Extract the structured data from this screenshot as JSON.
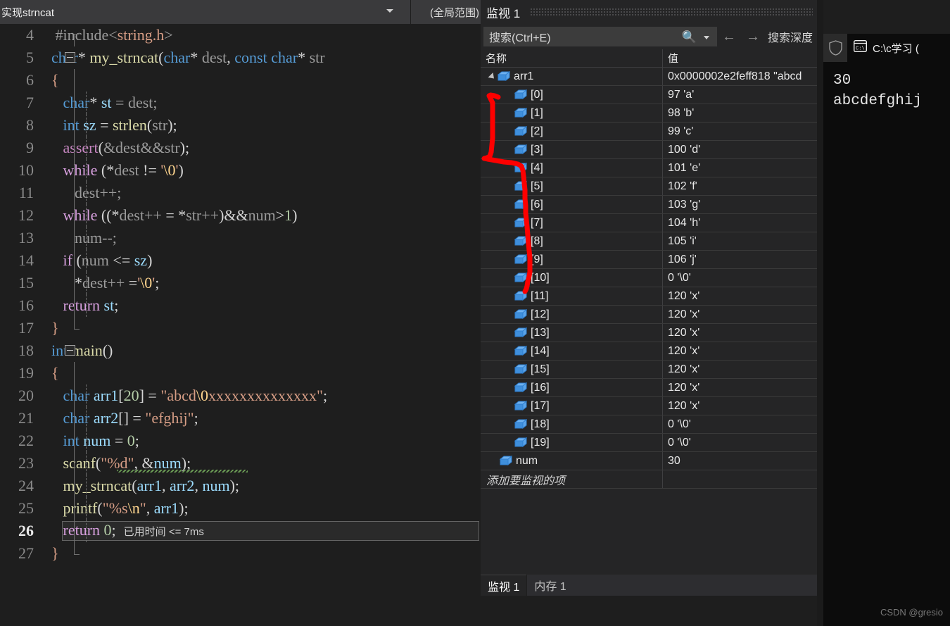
{
  "navbar": {
    "member_dropdown": "实现strncat",
    "scope_dropdown": "(全局范围)",
    "caret_icon": "chevron-down-icon"
  },
  "editor": {
    "current_line": 26,
    "inline_hint": "已用时间 <= 7ms",
    "lines": [
      {
        "n": 4,
        "text": "#include<string.h>"
      },
      {
        "n": 5,
        "text": "char* my_strncat(char* dest, const char* str"
      },
      {
        "n": 6,
        "text": "{"
      },
      {
        "n": 7,
        "text": "char* st = dest;"
      },
      {
        "n": 8,
        "text": "int sz = strlen(str);"
      },
      {
        "n": 9,
        "text": "assert(&dest&&str);"
      },
      {
        "n": 10,
        "text": "while (*dest != '\\0')"
      },
      {
        "n": 11,
        "text": "dest++;"
      },
      {
        "n": 12,
        "text": "while ((*dest++ = *str++)&&num>1)"
      },
      {
        "n": 13,
        "text": "num--;"
      },
      {
        "n": 14,
        "text": "if (num <= sz)"
      },
      {
        "n": 15,
        "text": "*dest++ ='\\0';"
      },
      {
        "n": 16,
        "text": "return st;"
      },
      {
        "n": 17,
        "text": "}"
      },
      {
        "n": 18,
        "text": "int main()"
      },
      {
        "n": 19,
        "text": "{"
      },
      {
        "n": 20,
        "text": "char arr1[20] = \"abcd\\0xxxxxxxxxxxxxx\";"
      },
      {
        "n": 21,
        "text": "char arr2[] = \"efghij\";"
      },
      {
        "n": 22,
        "text": "int num = 0;"
      },
      {
        "n": 23,
        "text": "scanf(\"%d\", &num);"
      },
      {
        "n": 24,
        "text": "my_strncat(arr1, arr2, num);"
      },
      {
        "n": 25,
        "text": "printf(\"%s\\n\", arr1);"
      },
      {
        "n": 26,
        "text": "return 0;"
      },
      {
        "n": 27,
        "text": "}"
      }
    ]
  },
  "watch": {
    "title": "监视 1",
    "search_placeholder": "搜索(Ctrl+E)",
    "search_icon": "search-icon",
    "search_caret_icon": "chevron-down-icon",
    "back_icon": "arrow-left-icon",
    "forward_icon": "arrow-right-icon",
    "depth_label": "搜索深度",
    "columns": {
      "name": "名称",
      "value": "值"
    },
    "add_item_placeholder": "添加要监视的项",
    "rows": [
      {
        "name": "arr1",
        "value": "0x0000002e2feff818 \"abcd",
        "level": 0,
        "expanded": true
      },
      {
        "name": "[0]",
        "value": "97 'a'",
        "level": 1
      },
      {
        "name": "[1]",
        "value": "98 'b'",
        "level": 1
      },
      {
        "name": "[2]",
        "value": "99 'c'",
        "level": 1
      },
      {
        "name": "[3]",
        "value": "100 'd'",
        "level": 1
      },
      {
        "name": "[4]",
        "value": "101 'e'",
        "level": 1
      },
      {
        "name": "[5]",
        "value": "102 'f'",
        "level": 1
      },
      {
        "name": "[6]",
        "value": "103 'g'",
        "level": 1
      },
      {
        "name": "[7]",
        "value": "104 'h'",
        "level": 1
      },
      {
        "name": "[8]",
        "value": "105 'i'",
        "level": 1
      },
      {
        "name": "[9]",
        "value": "106 'j'",
        "level": 1
      },
      {
        "name": "[10]",
        "value": "0 '\\0'",
        "level": 1
      },
      {
        "name": "[11]",
        "value": "120 'x'",
        "level": 1
      },
      {
        "name": "[12]",
        "value": "120 'x'",
        "level": 1
      },
      {
        "name": "[13]",
        "value": "120 'x'",
        "level": 1
      },
      {
        "name": "[14]",
        "value": "120 'x'",
        "level": 1
      },
      {
        "name": "[15]",
        "value": "120 'x'",
        "level": 1
      },
      {
        "name": "[16]",
        "value": "120 'x'",
        "level": 1
      },
      {
        "name": "[17]",
        "value": "120 'x'",
        "level": 1
      },
      {
        "name": "[18]",
        "value": "0 '\\0'",
        "level": 1
      },
      {
        "name": "[19]",
        "value": "0 '\\0'",
        "level": 1
      },
      {
        "name": "num",
        "value": "30",
        "level": 0
      }
    ],
    "tabs": [
      {
        "label": "监视 1",
        "active": true
      },
      {
        "label": "内存 1",
        "active": false
      }
    ]
  },
  "console": {
    "shield_icon": "shield-icon",
    "tab_icon": "command-prompt-icon",
    "tab_title": "C:\\c学习 (",
    "output": [
      "30",
      "abcdefghij"
    ]
  },
  "annotation": {
    "color": "#fe0000"
  },
  "watermark": "CSDN @gresio",
  "colors": {
    "editor_bg": "#1e1e1e",
    "panel_bg": "#252526",
    "toolbar_bg": "#2d2d30",
    "keyword": "#569cd6",
    "control_keyword": "#d8a0df",
    "function": "#dcdcaa",
    "string": "#d69d85",
    "escape": "#ffd68f",
    "number": "#b5cea8",
    "identifier": "#9cdcfe",
    "annotation_red": "#fe0000"
  }
}
